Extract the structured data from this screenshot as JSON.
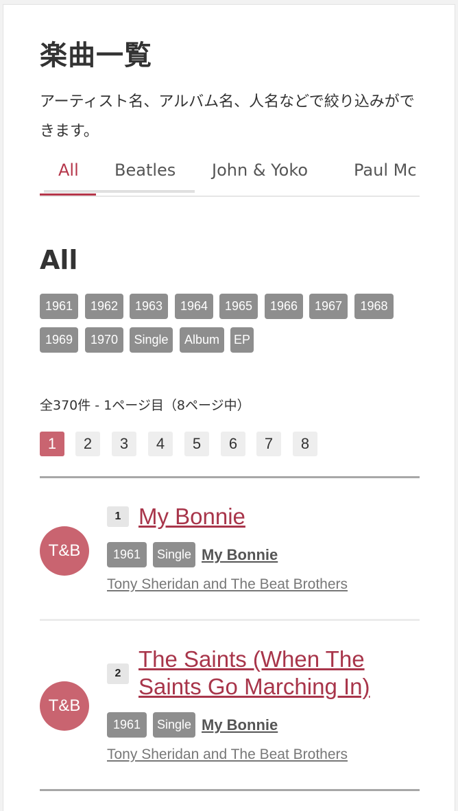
{
  "header": {
    "title": "楽曲一覧",
    "description": "アーティスト名、アルバム名、人名などで絞り込みができます。"
  },
  "tabs": [
    {
      "label": "All",
      "active": true
    },
    {
      "label": "Beatles",
      "active": false
    },
    {
      "label": "John & Yoko",
      "active": false
    },
    {
      "label": "Paul Mc",
      "active": false
    }
  ],
  "section": {
    "title": "All",
    "filters": [
      "1961",
      "1962",
      "1963",
      "1964",
      "1965",
      "1966",
      "1967",
      "1968",
      "1969",
      "1970",
      "Single",
      "Album",
      "EP"
    ]
  },
  "results": {
    "summary": "全370件 - 1ページ目（8ページ中）",
    "pages": [
      "1",
      "2",
      "3",
      "4",
      "5",
      "6",
      "7",
      "8"
    ],
    "current_page": "1"
  },
  "songs": [
    {
      "avatar": "T&B",
      "number": "1",
      "title": "My Bonnie",
      "year": "1961",
      "format": "Single",
      "album": "My Bonnie",
      "artist": "Tony Sheridan and The Beat Brothers"
    },
    {
      "avatar": "T&B",
      "number": "2",
      "title": "The Saints (When The Saints Go Marching In)",
      "year": "1961",
      "format": "Single",
      "album": "My Bonnie",
      "artist": "Tony Sheridan and The Beat Brothers"
    }
  ],
  "colors": {
    "accent": "#b5364a",
    "avatar": "#c96470",
    "tag": "#8e8e8e"
  }
}
